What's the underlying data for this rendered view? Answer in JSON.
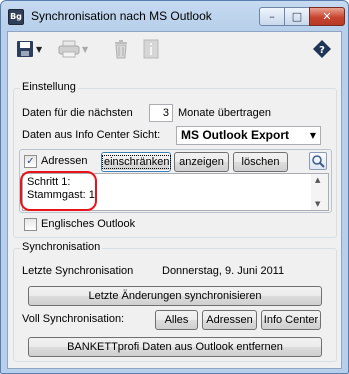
{
  "window": {
    "title": "Synchronisation nach MS Outlook",
    "app_icon_text": "Bg",
    "minimize": "–",
    "maximize": "□",
    "close": "✕"
  },
  "toolbar": {
    "items": [
      "save-icon",
      "print-icon",
      "delete-icon",
      "info-icon",
      "help-icon"
    ]
  },
  "settings": {
    "group_label": "Einstellung",
    "days_label": "Daten für die nächsten",
    "months_value": "3",
    "months_suffix": "Monate übertragen",
    "view_label": "Daten aus Info Center Sicht:",
    "view_value": "MS Outlook Export",
    "addresses_checkbox": "Adressen",
    "addresses_checked": true,
    "restrict_button": "einschränken",
    "show_button": "anzeigen",
    "delete_button": "löschen",
    "memo_lines": [
      "Schritt 1:",
      "Stammgast: 1"
    ],
    "english_outlook": "Englisches Outlook",
    "english_checked": false
  },
  "sync": {
    "group_label": "Synchronisation",
    "last_sync_label": "Letzte Synchronisation",
    "last_sync_value": "Donnerstag, 9. Juni 2011",
    "sync_changes_button": "Letzte Änderungen synchronisieren",
    "full_sync_label": "Voll Synchronisation:",
    "all_button": "Alles",
    "addresses_button": "Adressen",
    "info_center_button": "Info Center",
    "remove_button": "BANKETTprofi Daten aus Outlook entfernen"
  },
  "colors": {
    "highlight_ring": "#e8141c",
    "close_button": "#c7442e",
    "window_frame": "#b7cfea"
  }
}
